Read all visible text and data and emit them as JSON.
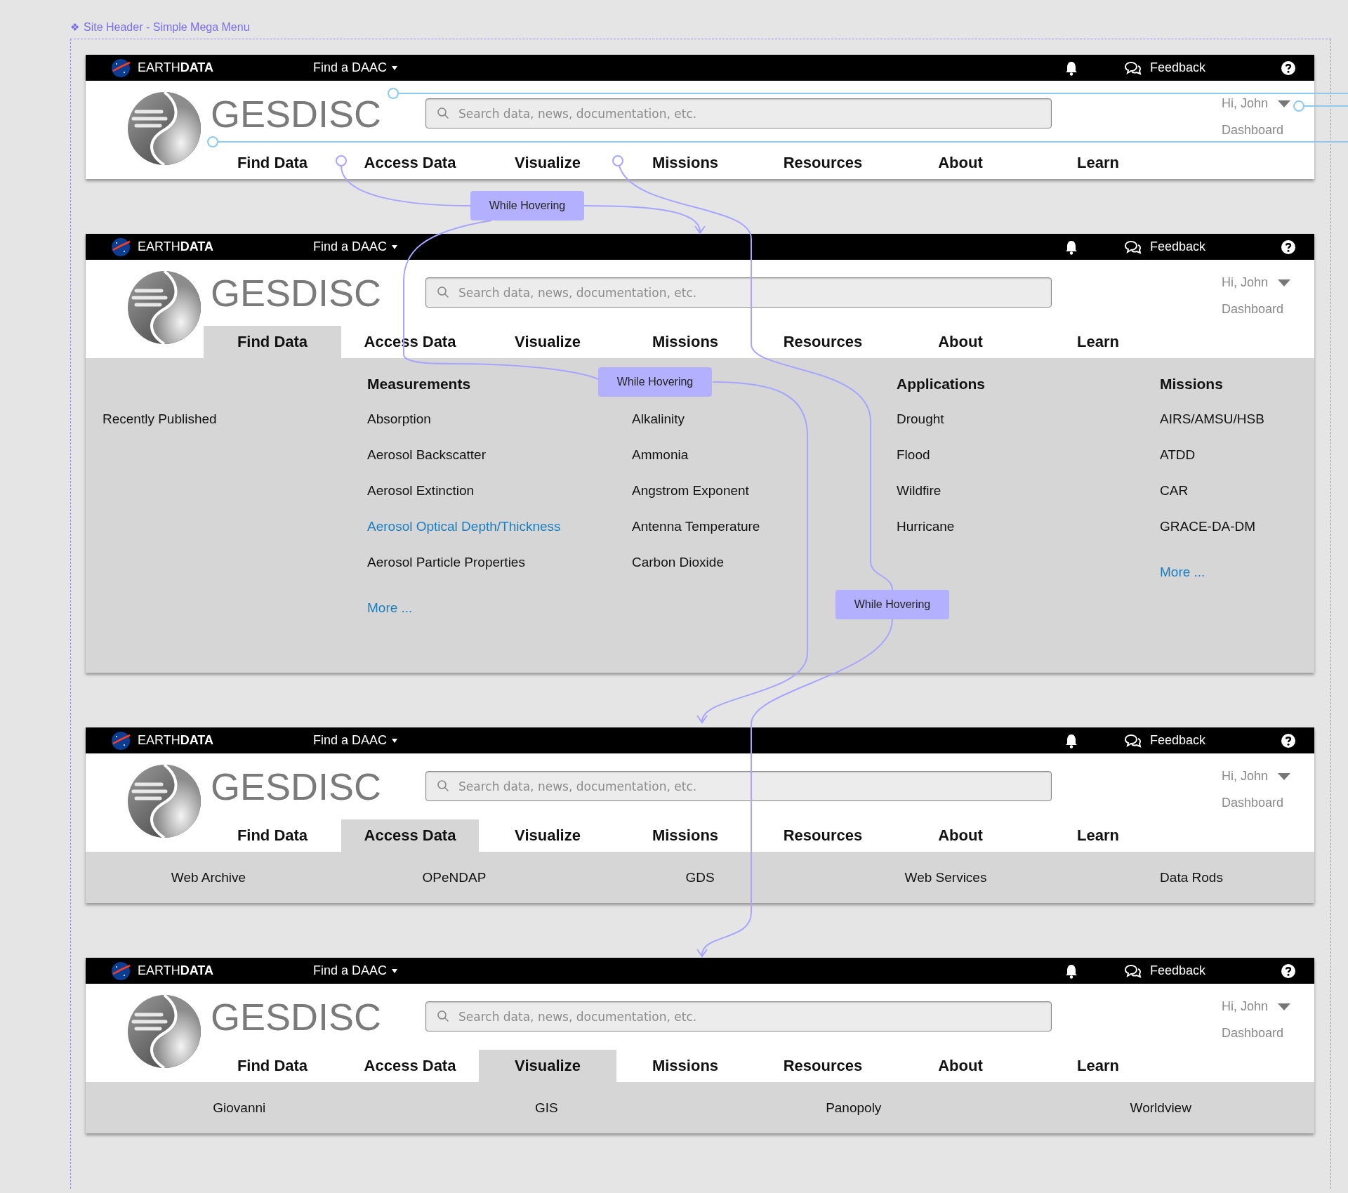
{
  "canvas": {
    "frame_icon": "❖",
    "frame_label": "Site Header - Simple Mega Menu"
  },
  "headers": [
    {
      "top_bar": {
        "brand": "EARTH**DATA**",
        "daac": "Find a DAAC",
        "feedback": "Feedback"
      },
      "title": "GESDISC",
      "search": {
        "placeholder": "Search data, news, documentation, etc."
      },
      "user": {
        "greeting": "Hi, John",
        "link": "Dashboard"
      },
      "nav": [
        {
          "label": "Find Data",
          "selected": false
        },
        {
          "label": "Access Data",
          "selected": false
        },
        {
          "label": "Visualize",
          "selected": false
        },
        {
          "label": "Missions",
          "selected": false
        },
        {
          "label": "Resources",
          "selected": false
        },
        {
          "label": "About",
          "selected": false
        },
        {
          "label": "Learn",
          "selected": false
        }
      ]
    },
    {
      "top_bar": {
        "brand": "EARTH**DATA**",
        "daac": "Find a DAAC",
        "feedback": "Feedback"
      },
      "title": "GESDISC",
      "search": {
        "placeholder": "Search data, news, documentation, etc."
      },
      "user": {
        "greeting": "Hi, John",
        "link": "Dashboard"
      },
      "nav": [
        {
          "label": "Find Data",
          "selected": true
        },
        {
          "label": "Access Data",
          "selected": false
        },
        {
          "label": "Visualize",
          "selected": false
        },
        {
          "label": "Missions",
          "selected": false
        },
        {
          "label": "Resources",
          "selected": false
        },
        {
          "label": "About",
          "selected": false
        },
        {
          "label": "Learn",
          "selected": false
        }
      ],
      "dropdown": {
        "kind": "mega",
        "columns": [
          {
            "items": [
              {
                "label": "Recently Published",
                "highlighted": false
              }
            ]
          },
          {
            "heading": "Measurements",
            "items": [
              {
                "label": "Absorption",
                "highlighted": false
              },
              {
                "label": "Aerosol Backscatter",
                "highlighted": false
              },
              {
                "label": "Aerosol Extinction",
                "highlighted": false
              },
              {
                "label": "Aerosol Optical Depth/Thickness",
                "highlighted": true
              },
              {
                "label": "Aerosol Particle Properties",
                "highlighted": false
              }
            ],
            "more": "More ..."
          },
          {
            "items": [
              {
                "label": "Alkalinity",
                "highlighted": false
              },
              {
                "label": "Ammonia",
                "highlighted": false
              },
              {
                "label": "Angstrom Exponent",
                "highlighted": false
              },
              {
                "label": "Antenna Temperature",
                "highlighted": false
              },
              {
                "label": "Carbon Dioxide",
                "highlighted": false
              }
            ]
          },
          {
            "heading": "Applications",
            "items": [
              {
                "label": "Drought",
                "highlighted": false
              },
              {
                "label": "Flood",
                "highlighted": false
              },
              {
                "label": "Wildfire",
                "highlighted": false
              },
              {
                "label": "Hurricane",
                "highlighted": false
              }
            ]
          },
          {
            "heading": "Missions",
            "items": [
              {
                "label": "AIRS/AMSU/HSB",
                "highlighted": false
              },
              {
                "label": "ATDD",
                "highlighted": false
              },
              {
                "label": "CAR",
                "highlighted": false
              },
              {
                "label": "GRACE-DA-DM",
                "highlighted": false
              }
            ],
            "more": "More ..."
          }
        ]
      }
    },
    {
      "top_bar": {
        "brand": "EARTH**DATA**",
        "daac": "Find a DAAC",
        "feedback": "Feedback"
      },
      "title": "GESDISC",
      "search": {
        "placeholder": "Search data, news, documentation, etc."
      },
      "user": {
        "greeting": "Hi, John",
        "link": "Dashboard"
      },
      "nav": [
        {
          "label": "Find Data",
          "selected": false
        },
        {
          "label": "Access Data",
          "selected": true
        },
        {
          "label": "Visualize",
          "selected": false
        },
        {
          "label": "Missions",
          "selected": false
        },
        {
          "label": "Resources",
          "selected": false
        },
        {
          "label": "About",
          "selected": false
        },
        {
          "label": "Learn",
          "selected": false
        }
      ],
      "dropdown": {
        "kind": "links",
        "items": [
          "Web Archive",
          "OPeNDAP",
          "GDS",
          "Web Services",
          "Data Rods"
        ]
      }
    },
    {
      "top_bar": {
        "brand": "EARTH**DATA**",
        "daac": "Find a DAAC",
        "feedback": "Feedback"
      },
      "title": "GESDISC",
      "search": {
        "placeholder": "Search data, news, documentation, etc."
      },
      "user": {
        "greeting": "Hi, John",
        "link": "Dashboard"
      },
      "nav": [
        {
          "label": "Find Data",
          "selected": false
        },
        {
          "label": "Access Data",
          "selected": false
        },
        {
          "label": "Visualize",
          "selected": true
        },
        {
          "label": "Missions",
          "selected": false
        },
        {
          "label": "Resources",
          "selected": false
        },
        {
          "label": "About",
          "selected": false
        },
        {
          "label": "Learn",
          "selected": false
        }
      ],
      "dropdown": {
        "kind": "links",
        "items": [
          "Giovanni",
          "GIS",
          "Panopoly",
          "Worldview"
        ]
      }
    }
  ],
  "interactions": [
    {
      "label": "While Hovering"
    },
    {
      "label": "While Hovering"
    },
    {
      "label": "While Hovering"
    }
  ]
}
